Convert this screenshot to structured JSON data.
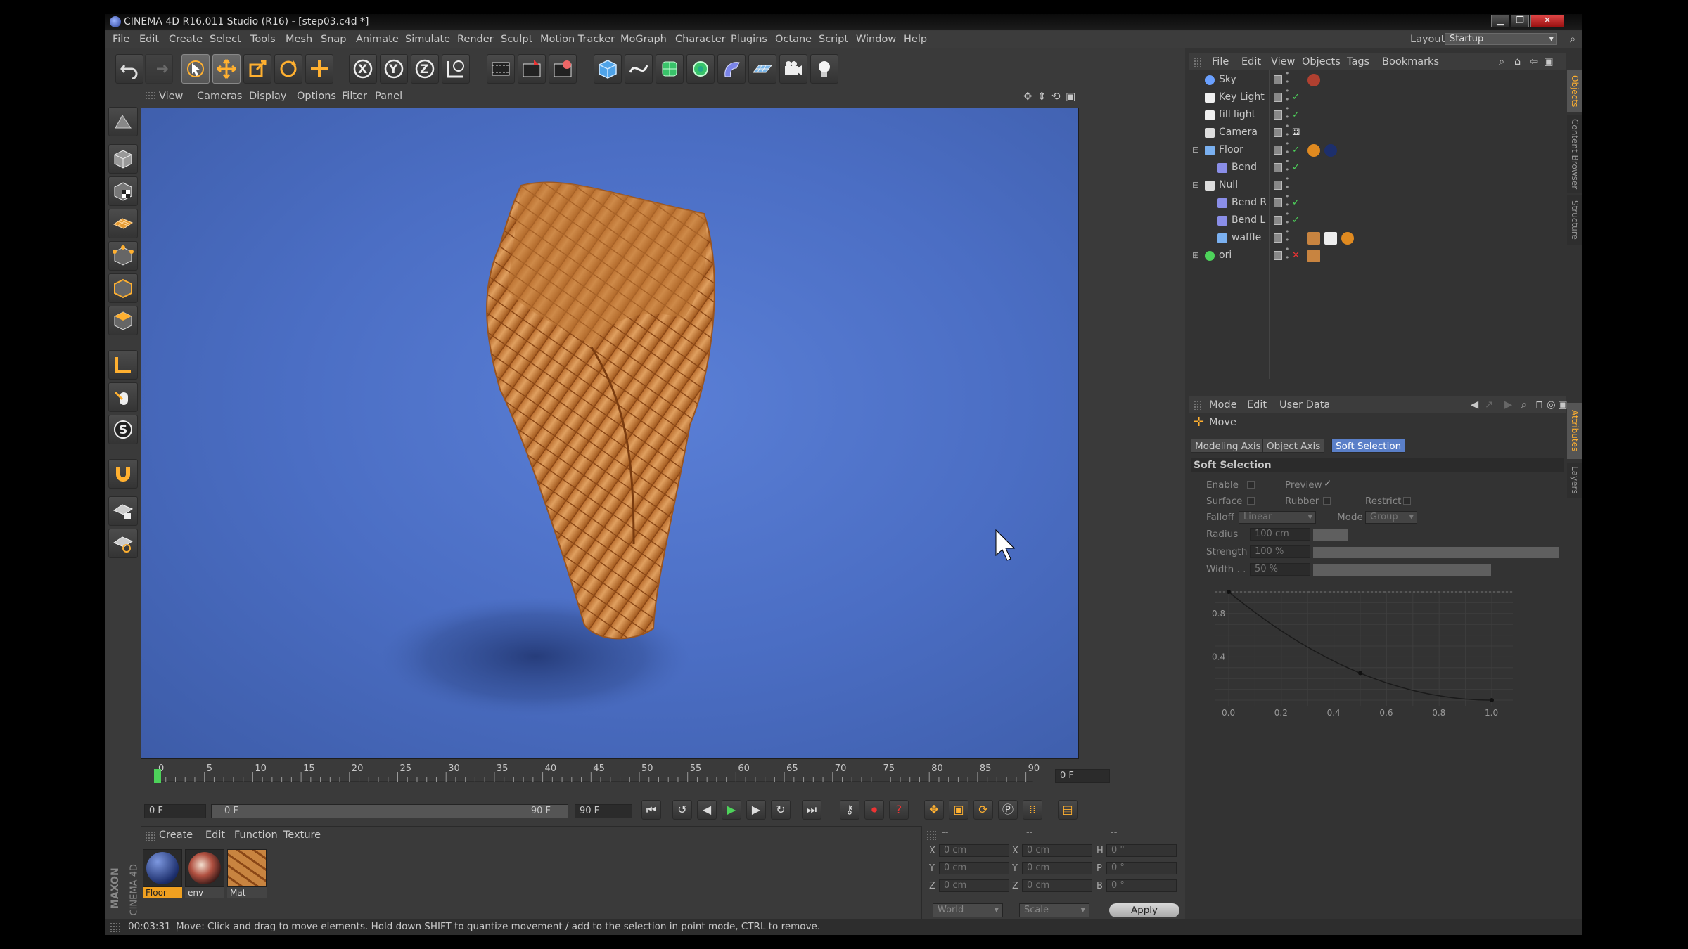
{
  "window": {
    "title": "CINEMA 4D R16.011 Studio (R16) - [step03.c4d *]",
    "minimize": "▁",
    "maximize": "❐",
    "close": "✕"
  },
  "menubar": {
    "items": [
      "File",
      "Edit",
      "Create",
      "Select",
      "Tools",
      "Mesh",
      "Snap",
      "Animate",
      "Simulate",
      "Render",
      "Sculpt",
      "Motion Tracker",
      "MoGraph",
      "Character",
      "Plugins",
      "Octane",
      "Script",
      "Window",
      "Help"
    ],
    "layout_label": "Layout:",
    "layout_value": "Startup"
  },
  "toolbar": {
    "icons": [
      "undo-icon",
      "redo-icon",
      "live-select-icon",
      "move-icon",
      "scale-icon",
      "rotate-icon",
      "recent-tool-icon",
      "x-axis-icon",
      "y-axis-icon",
      "z-axis-icon",
      "world-coord-icon",
      "render-view-icon",
      "render-picture-viewer-icon",
      "edit-render-settings-icon",
      "cube-icon",
      "spline-pen-icon",
      "subdivision-icon",
      "array-icon",
      "deformer-icon",
      "floor-icon",
      "camera-icon",
      "light-icon"
    ]
  },
  "viewport": {
    "menu": [
      "View",
      "Cameras",
      "Display",
      "Options",
      "Filter",
      "Panel"
    ]
  },
  "timeline": {
    "ticks": [
      "0",
      "5",
      "10",
      "15",
      "20",
      "25",
      "30",
      "35",
      "40",
      "45",
      "50",
      "55",
      "60",
      "65",
      "70",
      "75",
      "80",
      "85",
      "90"
    ],
    "current_frame": "0 F",
    "start_frame": "0 F",
    "range_start": "0 F",
    "range_end": "90 F",
    "end_frame": "90 F"
  },
  "materials": {
    "menu": [
      "Create",
      "Edit",
      "Function",
      "Texture"
    ],
    "items": [
      {
        "name": "Floor",
        "selected": true
      },
      {
        "name": "env",
        "selected": false
      },
      {
        "name": "Mat",
        "selected": false
      }
    ]
  },
  "coordinates": {
    "headers": [
      "--",
      "--",
      "--"
    ],
    "rows": [
      {
        "a": "X",
        "av": "0 cm",
        "b": "X",
        "bv": "0 cm",
        "c": "H",
        "cv": "0 °"
      },
      {
        "a": "Y",
        "av": "0 cm",
        "b": "Y",
        "bv": "0 cm",
        "c": "P",
        "cv": "0 °"
      },
      {
        "a": "Z",
        "av": "0 cm",
        "b": "Z",
        "bv": "0 cm",
        "c": "B",
        "cv": "0 °"
      }
    ],
    "space": "World",
    "mode": "Scale",
    "apply": "Apply"
  },
  "status": {
    "time": "00:03:31",
    "message": "Move: Click and drag to move elements. Hold down SHIFT to quantize movement / add to the selection in point mode, CTRL to remove."
  },
  "object_manager": {
    "menu": [
      "File",
      "Edit",
      "View",
      "Objects",
      "Tags",
      "Bookmarks"
    ],
    "objects": [
      {
        "name": "Sky",
        "icon": "sky-icon",
        "indent": 0,
        "expand": ""
      },
      {
        "name": "Key Light",
        "icon": "light-icon",
        "indent": 0,
        "expand": ""
      },
      {
        "name": "fill light",
        "icon": "light-icon",
        "indent": 0,
        "expand": ""
      },
      {
        "name": "Camera",
        "icon": "camera-icon",
        "indent": 0,
        "expand": ""
      },
      {
        "name": "Floor",
        "icon": "floor-icon",
        "indent": 0,
        "expand": "−"
      },
      {
        "name": "Bend",
        "icon": "bend-icon",
        "indent": 1,
        "expand": ""
      },
      {
        "name": "Null",
        "icon": "null-icon",
        "indent": 0,
        "expand": "−"
      },
      {
        "name": "Bend R",
        "icon": "bend-icon",
        "indent": 1,
        "expand": ""
      },
      {
        "name": "Bend L",
        "icon": "bend-icon",
        "indent": 1,
        "expand": ""
      },
      {
        "name": "waffle",
        "icon": "polygon-icon",
        "indent": 1,
        "expand": ""
      },
      {
        "name": "ori",
        "icon": "sphere-icon",
        "indent": 0,
        "expand": "+"
      }
    ]
  },
  "attributes": {
    "menu": [
      "Mode",
      "Edit",
      "User Data"
    ],
    "tool_name": "Move",
    "tabs": [
      {
        "label": "Modeling Axis",
        "active": false
      },
      {
        "label": "Object Axis",
        "active": false
      },
      {
        "label": "Soft Selection",
        "active": true
      }
    ],
    "section": "Soft Selection",
    "enable": "Enable",
    "preview": "Preview",
    "preview_check": "✓",
    "surface": "Surface",
    "rubber": "Rubber",
    "restrict": "Restrict",
    "falloff_label": "Falloff",
    "falloff_value": "Linear",
    "mode_label": "Mode",
    "mode_value": "Group",
    "radius_label": "Radius",
    "radius_value": "100 cm",
    "radius_level": 0.1,
    "strength_label": "Strength",
    "strength_value": "100 %",
    "strength_level": 1.0,
    "width_label": "Width . .",
    "width_value": "50 %",
    "width_level": 0.5,
    "graph_x_ticks": [
      "0.0",
      "0.2",
      "0.4",
      "0.6",
      "0.8",
      "1.0"
    ],
    "graph_y_ticks": [
      "0.8",
      "0.4"
    ]
  },
  "side_tabs": {
    "objects": "Objects",
    "content": "Content Browser",
    "structure": "Structure",
    "attributes": "Attributes",
    "layers": "Layers"
  },
  "logo": {
    "maxon": "MAXON",
    "c4d": "CINEMA 4D"
  }
}
